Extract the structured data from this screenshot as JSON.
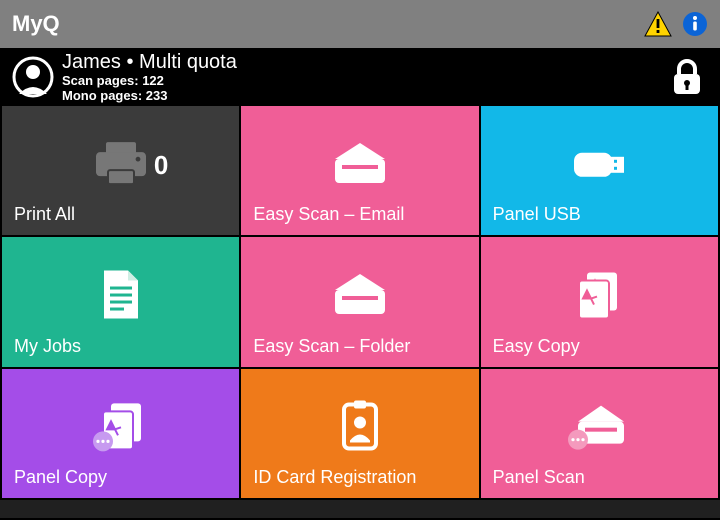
{
  "header": {
    "title": "MyQ"
  },
  "user": {
    "name": "James",
    "quota_label": "Multi quota",
    "scan_line": "Scan pages: 122",
    "mono_line": "Mono pages: 233"
  },
  "tiles": {
    "print_all": {
      "label": "Print All",
      "count": "0"
    },
    "scan_email": {
      "label": "Easy Scan – Email"
    },
    "panel_usb": {
      "label": "Panel USB"
    },
    "my_jobs": {
      "label": "My Jobs"
    },
    "scan_folder": {
      "label": "Easy Scan – Folder"
    },
    "easy_copy": {
      "label": "Easy Copy"
    },
    "panel_copy": {
      "label": "Panel Copy"
    },
    "id_card": {
      "label": "ID Card Registration"
    },
    "panel_scan": {
      "label": "Panel Scan"
    }
  }
}
